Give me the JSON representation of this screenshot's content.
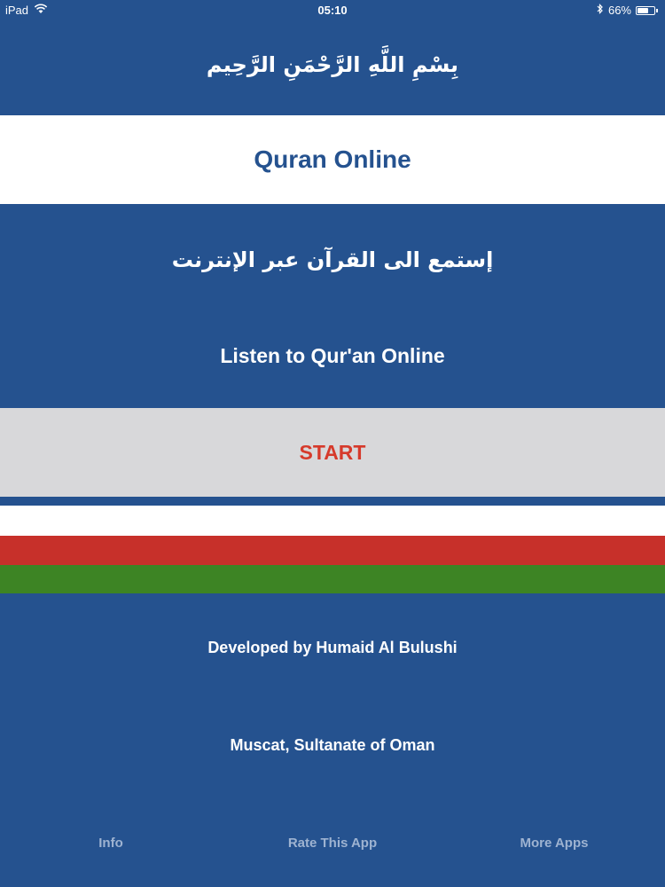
{
  "status_bar": {
    "device": "iPad",
    "time": "05:10",
    "battery_text": "66%",
    "battery_level": 0.66,
    "icons": [
      "wifi-icon",
      "bluetooth-icon",
      "battery-icon"
    ]
  },
  "header": {
    "bismillah": "بِسْمِ اللَّهِ الرَّحْمَنِ الرَّحِيم"
  },
  "title": "Quran Online",
  "subtitle_arabic": "إستمع الى القرآن عبر الإنترنت",
  "subtitle_english": "Listen to Qur'an Online",
  "start_button": "START",
  "flag_colors": [
    "#ffffff",
    "#c7302a",
    "#3d8424"
  ],
  "footer": {
    "developer": "Developed by Humaid Al Bulushi",
    "location": "Muscat, Sultanate of Oman"
  },
  "tabs": [
    {
      "label": "Info"
    },
    {
      "label": "Rate This App"
    },
    {
      "label": "More Apps"
    }
  ],
  "colors": {
    "background": "#25528f",
    "accent_red": "#d63a2b",
    "start_bg": "#d8d8da",
    "tab_text": "#9eb3d1"
  }
}
